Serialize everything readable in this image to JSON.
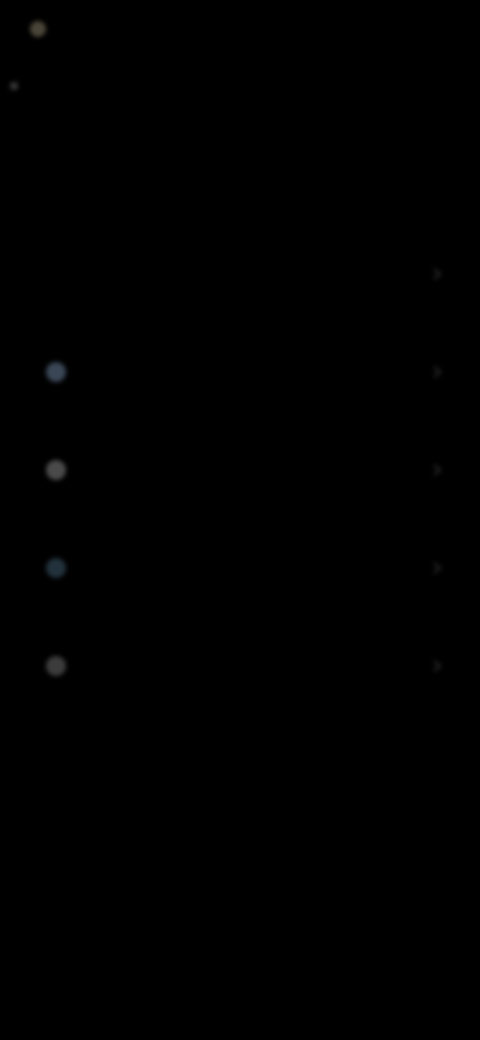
{
  "header": {
    "back_label": "",
    "action_label": "",
    "subtitle_top": "",
    "title": "",
    "subtitle_bottom": ""
  },
  "list": {
    "items": [
      {
        "label": "",
        "icon": "none"
      },
      {
        "label": "",
        "icon": "circle-icon"
      },
      {
        "label": "",
        "icon": "circle-icon"
      },
      {
        "label": "",
        "icon": "circle-icon"
      },
      {
        "label": "",
        "icon": "circle-icon"
      }
    ]
  },
  "colors": {
    "background": "#000000",
    "text_primary": "#e6e6e6",
    "text_secondary": "#8a8a8a",
    "accent_icon": "#3a4a5a"
  }
}
